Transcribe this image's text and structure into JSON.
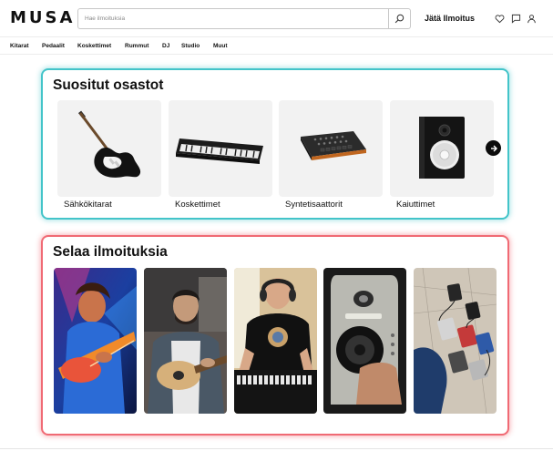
{
  "header": {
    "logo": "MUSA",
    "search_placeholder": "Hae ilmoituksia",
    "post_label": "Jätä Ilmoitus",
    "icons": [
      "heart-icon",
      "chat-icon",
      "user-icon"
    ]
  },
  "nav": {
    "items": [
      {
        "label": "Kitarat"
      },
      {
        "label": "Pedaalit"
      },
      {
        "label": "Koskettimet"
      },
      {
        "label": "Rummut"
      },
      {
        "label": "DJ"
      },
      {
        "label": "Studio"
      },
      {
        "label": "Muut"
      }
    ]
  },
  "popular": {
    "title": "Suositut osastot",
    "categories": [
      {
        "label": "Sähkökitarat",
        "icon": "electric-guitar-image"
      },
      {
        "label": "Koskettimet",
        "icon": "keyboard-image"
      },
      {
        "label": "Syntetisaattorit",
        "icon": "synthesizer-image"
      },
      {
        "label": "Kaiuttimet",
        "icon": "speaker-image"
      }
    ],
    "next_icon": "arrow-right-icon"
  },
  "browse": {
    "title": "Selaa ilmoituksia",
    "thumbnails": [
      {
        "icon": "guitarist-illustration-image"
      },
      {
        "icon": "man-playing-guitar-image"
      },
      {
        "icon": "keyboard-player-image"
      },
      {
        "icon": "studio-monitor-image"
      },
      {
        "icon": "guitar-pedals-image"
      }
    ]
  },
  "colors": {
    "popular_border": "#43c4c9",
    "browse_border": "#f06a74",
    "card_bg": "#f2f2f2"
  }
}
